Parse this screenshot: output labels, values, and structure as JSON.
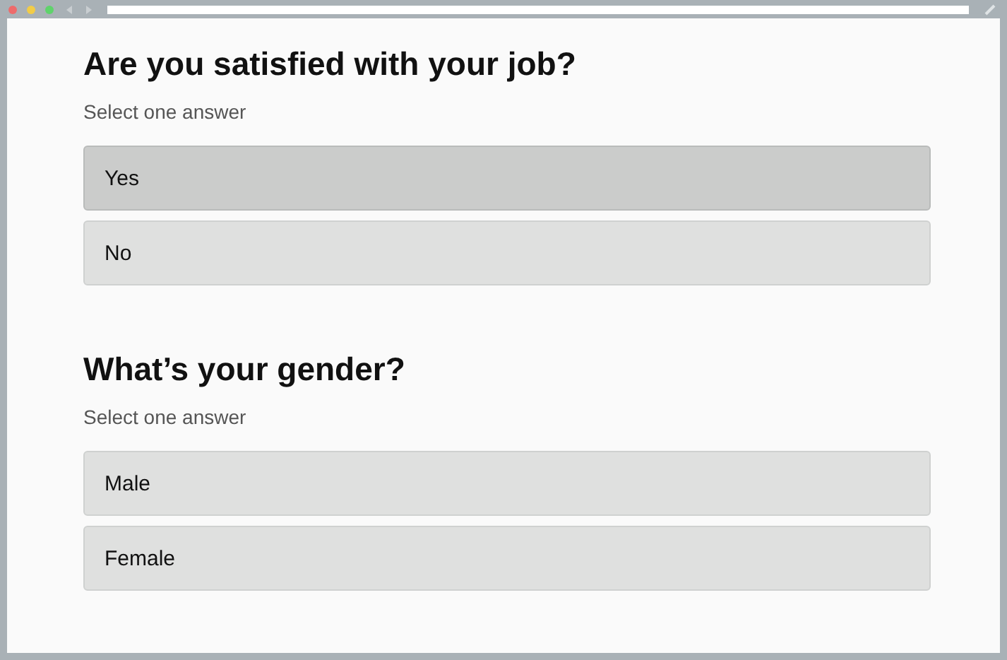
{
  "questions": [
    {
      "title": "Are you satisfied with your job?",
      "hint": "Select one answer",
      "options": [
        {
          "label": "Yes",
          "selected": true
        },
        {
          "label": "No",
          "selected": false
        }
      ]
    },
    {
      "title": "What’s your gender?",
      "hint": "Select one answer",
      "options": [
        {
          "label": "Male",
          "selected": false
        },
        {
          "label": "Female",
          "selected": false
        }
      ]
    }
  ]
}
